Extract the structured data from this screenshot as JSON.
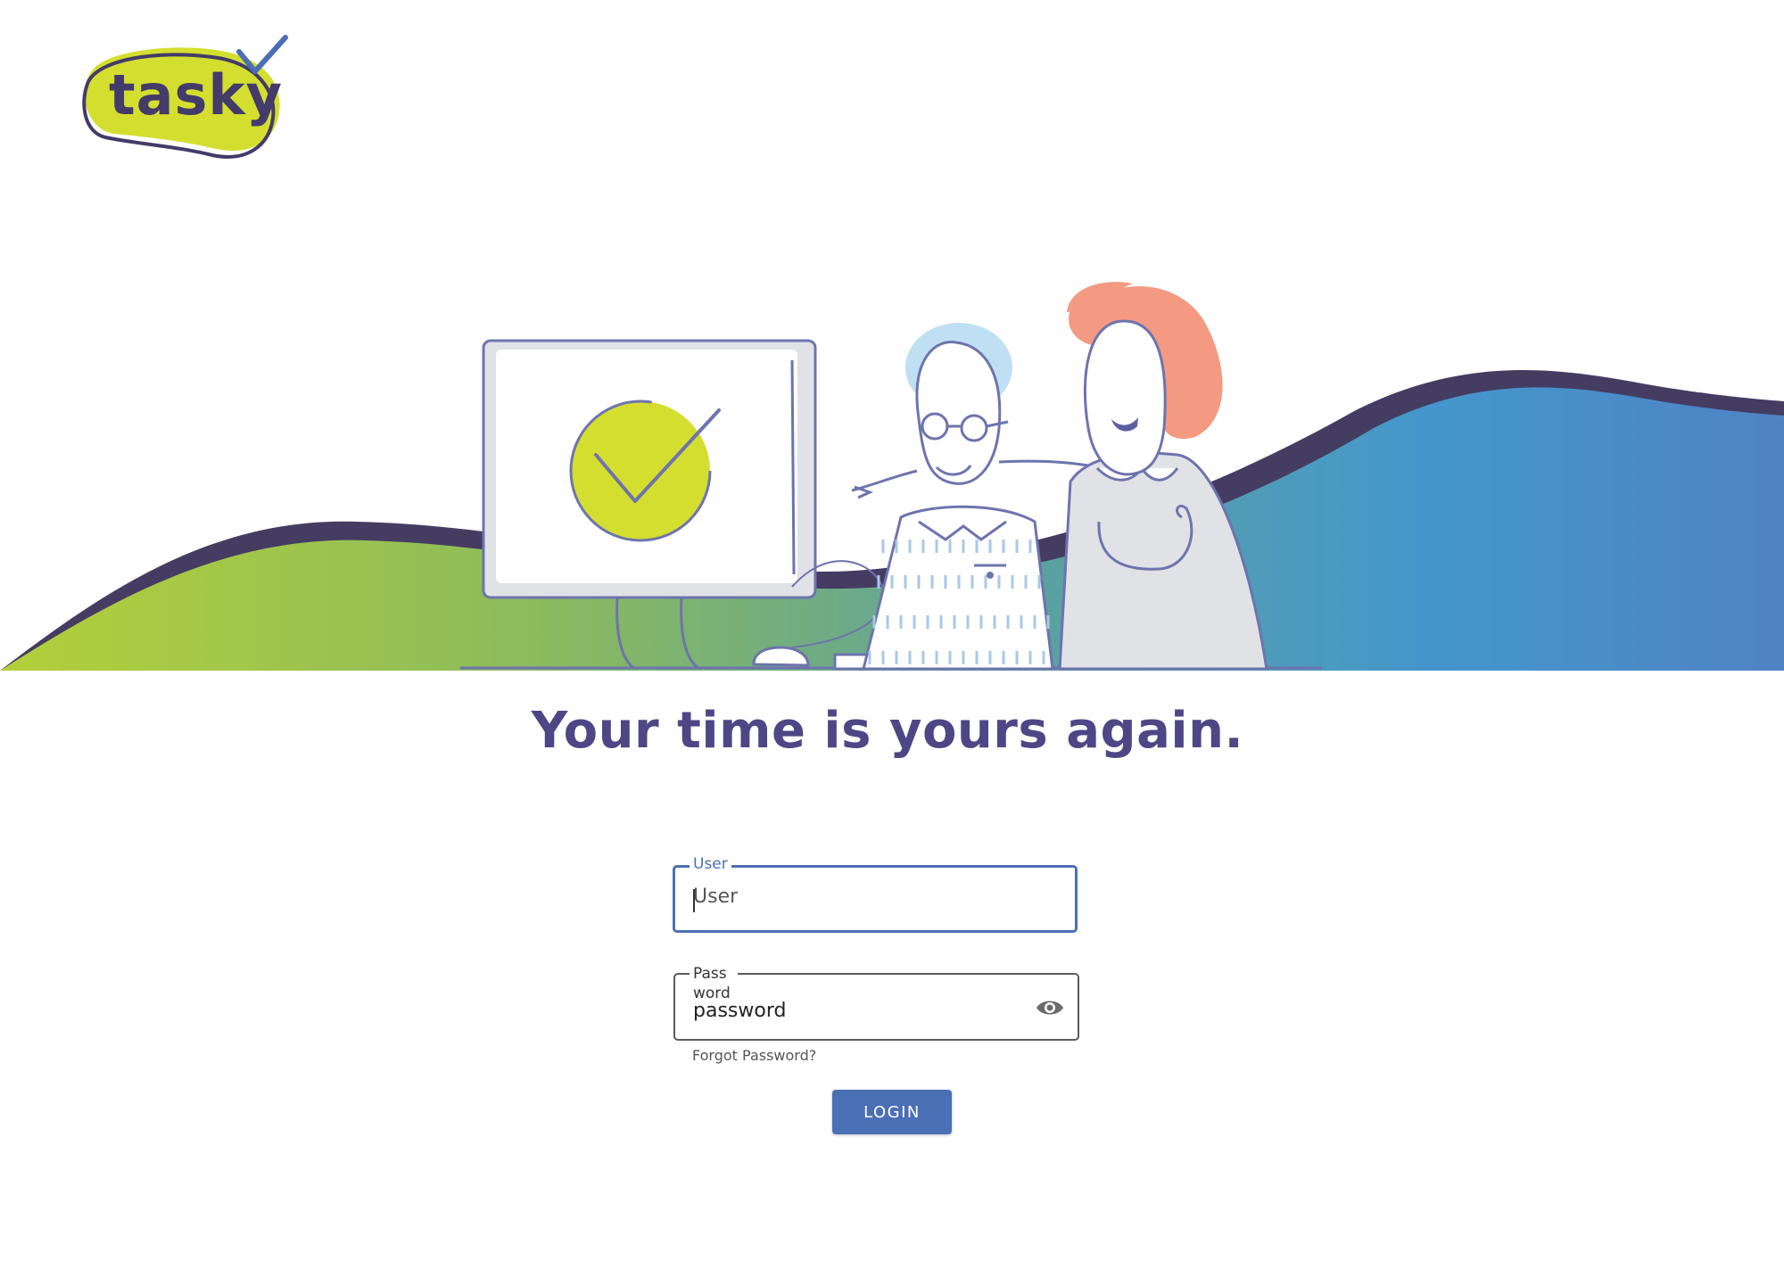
{
  "app": {
    "logo_text": "tasky"
  },
  "hero": {
    "tagline": "Your time is yours again."
  },
  "login_form": {
    "user_label": "User",
    "user_placeholder": "User",
    "password_label": "Pass word",
    "password_placeholder": "password",
    "forgot_password": "Forgot Password?",
    "login_button": "LOGIN"
  },
  "colors": {
    "brand_purple": "#433b6a",
    "brand_lime": "#d4de2f",
    "accent_blue": "#4b6fb5",
    "tagline": "#4e4685"
  },
  "icons": {
    "password_toggle": "eye-icon",
    "logo_check": "checkmark-icon"
  }
}
